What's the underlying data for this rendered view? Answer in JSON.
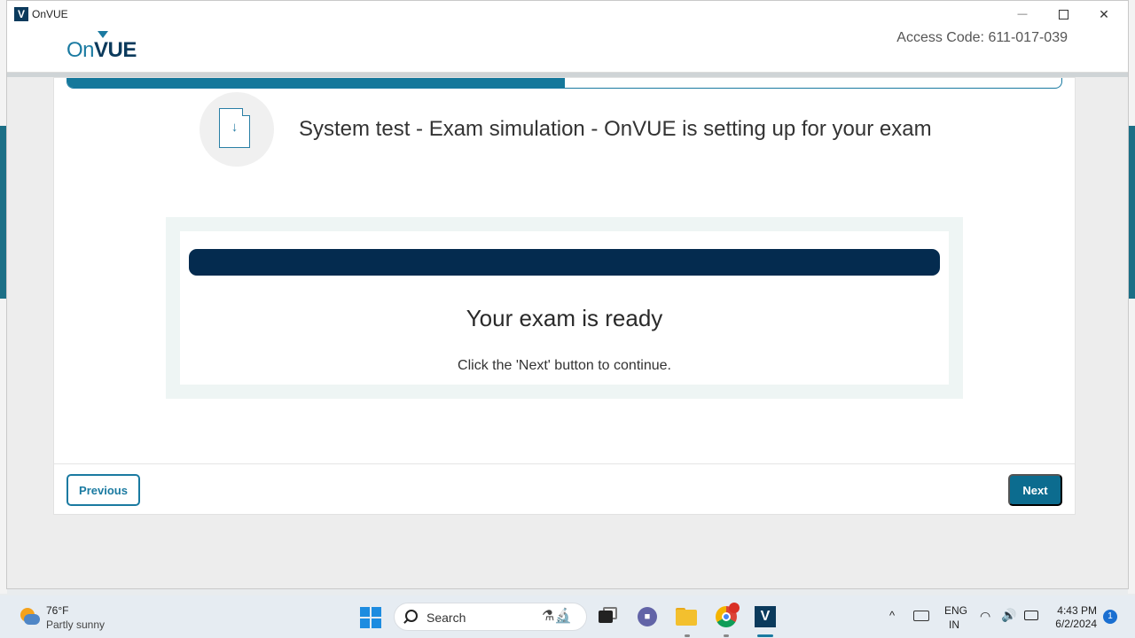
{
  "window": {
    "app_icon_letter": "V",
    "title": "OnVUE",
    "controls": {
      "minimize": "—",
      "close": "✕"
    }
  },
  "header": {
    "logo_on": "On",
    "logo_vue": "VUE",
    "access_code": "Access Code: 611-017-039"
  },
  "progress": {
    "fraction": 0.5
  },
  "step": {
    "icon": "document-download-icon",
    "icon_glyph": "↓",
    "title": "System test - Exam simulation - OnVUE is setting up for your exam"
  },
  "status": {
    "title": "Your exam is ready",
    "subtitle": "Click the 'Next' button to continue."
  },
  "buttons": {
    "previous": "Previous",
    "next": "Next"
  },
  "taskbar": {
    "weather": {
      "temp": "76°F",
      "desc": "Partly sunny"
    },
    "search_label": "Search",
    "search_deco": "⚗🔬",
    "teams_glyph": "■",
    "vue_glyph": "V",
    "tray": {
      "chevron": "^",
      "lang_line1": "ENG",
      "lang_line2": "IN",
      "wifi": "◠",
      "volume": "🔊",
      "time": "4:43 PM",
      "date": "6/2/2024",
      "notifications": "1"
    }
  },
  "colors": {
    "brand_navy": "#0b3a5c",
    "brand_teal": "#1a7aa1",
    "ready_bar": "#042b4f",
    "next_button": "#0c6c8f"
  }
}
